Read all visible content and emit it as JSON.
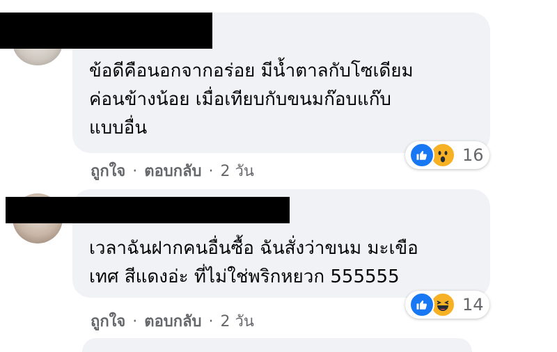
{
  "comments": [
    {
      "text_lines": [
        "ข้อดีคือนอกจากอร่อย มีน้ำตาลกับโซเดียม",
        "ค่อนข้างน้อย เมื่อเทียบกับขนมก๊อบแก๊บ",
        "แบบอื่น"
      ],
      "reaction_count": "16",
      "reaction_icons": [
        "like-icon",
        "wow-icon"
      ],
      "like_label": "ถูกใจ",
      "reply_label": "ตอบกลับ",
      "time": "2 วัน"
    },
    {
      "text_lines": [
        "เวลาฉันฝากคนอื่นซื้อ ฉันสั่งว่าขนม มะเขือ",
        "เทศ สีแดงอ่ะ ที่ไม่ใช่พริกหยวก 555555"
      ],
      "reaction_count": "14",
      "reaction_icons": [
        "like-icon",
        "haha-icon"
      ],
      "like_label": "ถูกใจ",
      "reply_label": "ตอบกลับ",
      "time": "2 วัน"
    }
  ],
  "separator": "·",
  "colors": {
    "bubble": "#f0f2f5",
    "like_blue": "#1877f2",
    "emoji_yellow": "#f7b125",
    "meta_gray": "#65676b",
    "redaction": "#000000"
  }
}
